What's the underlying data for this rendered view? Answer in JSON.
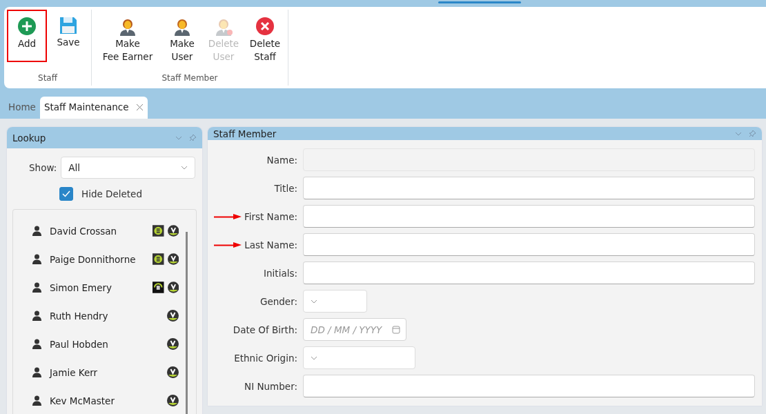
{
  "ribbon": {
    "groups": [
      {
        "label": "Staff",
        "buttons": [
          {
            "kind": "add",
            "lines": [
              "Add"
            ],
            "disabled": false,
            "highlighted": true
          },
          {
            "kind": "save",
            "lines": [
              "Save"
            ],
            "disabled": false,
            "highlighted": false
          }
        ]
      },
      {
        "label": "Staff Member",
        "buttons": [
          {
            "kind": "woman",
            "lines": [
              "Make",
              "Fee Earner"
            ],
            "disabled": false,
            "highlighted": false
          },
          {
            "kind": "man",
            "lines": [
              "Make",
              "User"
            ],
            "disabled": false,
            "highlighted": false
          },
          {
            "kind": "man-delete",
            "lines": [
              "Delete",
              "User"
            ],
            "disabled": true,
            "highlighted": false
          },
          {
            "kind": "delete",
            "lines": [
              "Delete",
              "Staff"
            ],
            "disabled": false,
            "highlighted": false
          }
        ]
      }
    ]
  },
  "tabs": [
    {
      "label": "Home",
      "selected": false,
      "closable": false
    },
    {
      "label": "Staff Maintenance",
      "selected": true,
      "closable": true
    }
  ],
  "lookup": {
    "title": "Lookup",
    "show_label": "Show:",
    "show_value": "All",
    "hide_deleted": {
      "label": "Hide Deleted",
      "checked": true
    },
    "staff": [
      {
        "name": "David Crossan",
        "badges": [
          {
            "kind": "e"
          },
          {
            "kind": "v"
          }
        ]
      },
      {
        "name": "Paige Donnithorne",
        "badges": [
          {
            "kind": "e"
          },
          {
            "kind": "v"
          }
        ]
      },
      {
        "name": "Simon Emery",
        "badges": [
          {
            "kind": "s"
          },
          {
            "kind": "v"
          }
        ]
      },
      {
        "name": "Ruth Hendry",
        "badges": [
          {
            "kind": "v"
          }
        ]
      },
      {
        "name": "Paul Hobden",
        "badges": [
          {
            "kind": "v"
          }
        ]
      },
      {
        "name": "Jamie Kerr",
        "badges": [
          {
            "kind": "v"
          }
        ]
      },
      {
        "name": "Kev McMaster",
        "badges": [
          {
            "kind": "v"
          }
        ]
      }
    ]
  },
  "staff_member": {
    "title": "Staff Member",
    "fields": [
      {
        "label": "Name:",
        "kind": "readonly",
        "arrow": false
      },
      {
        "label": "Title:",
        "kind": "text",
        "arrow": false
      },
      {
        "label": "First Name:",
        "kind": "text",
        "arrow": true
      },
      {
        "label": "Last Name:",
        "kind": "text",
        "arrow": true
      },
      {
        "label": "Initials:",
        "kind": "text",
        "arrow": false
      },
      {
        "label": "Gender:",
        "kind": "select-small",
        "arrow": false
      },
      {
        "label": "Date Of Birth:",
        "kind": "date",
        "placeholder": "DD / MM / YYYY",
        "arrow": false
      },
      {
        "label": "Ethnic Origin:",
        "kind": "select",
        "arrow": false
      },
      {
        "label": "NI Number:",
        "kind": "text",
        "arrow": false
      }
    ]
  }
}
